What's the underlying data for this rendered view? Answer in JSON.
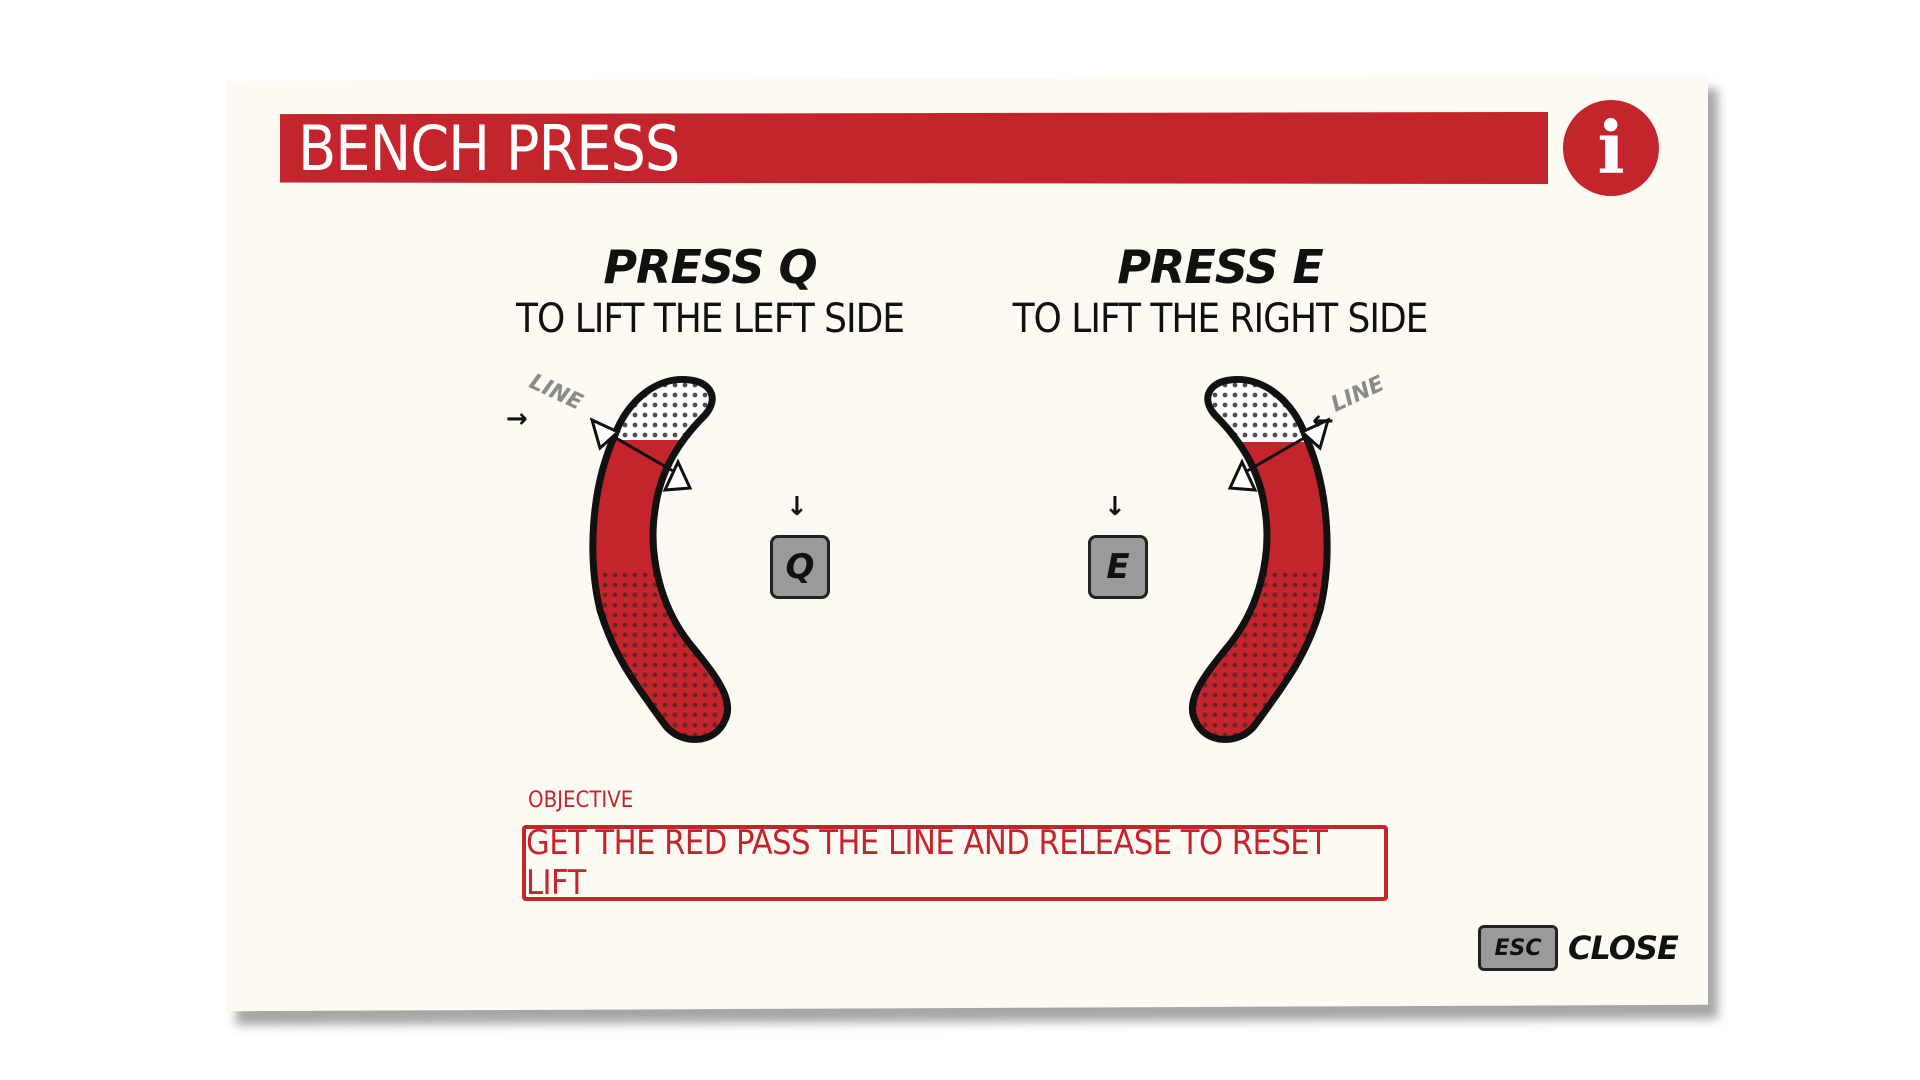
{
  "title": "BENCH PRESS",
  "info_icon": "info-icon",
  "instructions": {
    "left": {
      "key_line": "PRESS Q",
      "desc": "TO LIFT THE LEFT SIDE",
      "key": "Q",
      "line_label": "LINE"
    },
    "right": {
      "key_line": "PRESS E",
      "desc": "TO LIFT THE RIGHT SIDE",
      "key": "E",
      "line_label": "LINE"
    }
  },
  "objective": {
    "label": "OBJECTIVE",
    "text": "GET THE RED PASS THE LINE AND RELEASE TO RESET LIFT"
  },
  "close": {
    "key": "ESC",
    "label": "CLOSE"
  },
  "colors": {
    "accent": "#c4242b",
    "paper": "#fdfaf3",
    "key_gray": "#9a9a9a"
  }
}
